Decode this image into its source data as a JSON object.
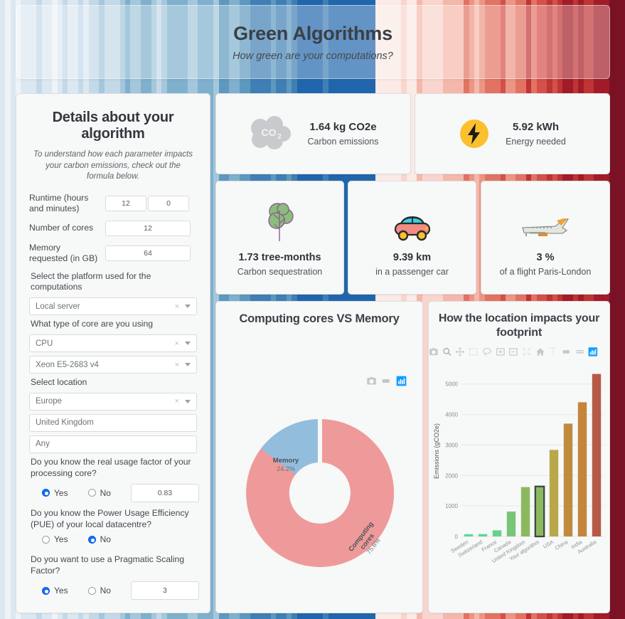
{
  "header": {
    "title": "Green Algorithms",
    "subtitle": "How green are your computations?"
  },
  "form": {
    "title": "Details about your algorithm",
    "note": "To understand how each parameter impacts your carbon emissions, check out the formula below.",
    "runtime_label": "Runtime (hours and minutes)",
    "runtime_hours": "12",
    "runtime_minutes": "0",
    "cores_label": "Number of cores",
    "cores_value": "12",
    "memory_label": "Memory requested (in GB)",
    "memory_value": "64",
    "platform_label": "Select the platform used for the computations",
    "platform_value": "Local server",
    "core_type_label": "What type of core are you using",
    "core_type_value": "CPU",
    "core_model_value": "Xeon E5-2683 v4",
    "location_label": "Select location",
    "location_continent": "Europe",
    "location_country": "United Kingdom",
    "location_region": "Any",
    "usage_label": "Do you know the real usage factor of your processing core?",
    "usage_yes": "Yes",
    "usage_no": "No",
    "usage_selected": "Yes",
    "usage_value": "0.83",
    "pue_label": "Do you know the Power Usage Efficiency (PUE) of your local datacentre?",
    "pue_yes": "Yes",
    "pue_no": "No",
    "pue_selected": "No",
    "psf_label": "Do you want to use a Pragmatic Scaling Factor?",
    "psf_yes": "Yes",
    "psf_no": "No",
    "psf_selected": "Yes",
    "psf_value": "3",
    "clear_symbol": "×"
  },
  "metrics": [
    {
      "icon": "co2-cloud-icon",
      "value": "1.64 kg CO2e",
      "label": "Carbon emissions"
    },
    {
      "icon": "lightning-bolt-icon",
      "value": "5.92 kWh",
      "label": "Energy needed"
    }
  ],
  "equivalents": [
    {
      "icon": "tree-icon",
      "value": "1.73 tree-months",
      "label": "Carbon sequestration"
    },
    {
      "icon": "car-icon",
      "value": "9.39 km",
      "label": "in a passenger car"
    },
    {
      "icon": "airplane-icon",
      "value": "3 %",
      "label": "of a flight Paris-London"
    }
  ],
  "colors": {
    "memory": "#93bddc",
    "cores": "#ef9a9a",
    "highlight_border": "#3a4348",
    "accent_blue": "#0d6efd",
    "plotly_logo": "#119dff"
  },
  "chart_data": [
    {
      "type": "pie",
      "title": "Computing cores VS Memory",
      "hole": 0.42,
      "labels": [
        "Memory",
        "Computing cores"
      ],
      "values": [
        24.2,
        75.8
      ],
      "value_suffix": "%",
      "colors": [
        "#93bddc",
        "#ef9a9a"
      ],
      "slice_text": [
        "Memory\n24.2%",
        "Computing cores\n75.8%"
      ],
      "legend": "none",
      "modebar": [
        "camera-icon",
        "hover-closest-icon",
        "plotly-logo-icon"
      ]
    },
    {
      "type": "bar",
      "title": "How the location impacts your footprint",
      "xlabel": "",
      "ylabel": "Emissions (gCO2e)",
      "ylim": [
        0,
        5600
      ],
      "yticks": [
        0,
        1000,
        2000,
        3000,
        4000,
        5000
      ],
      "grid": true,
      "categories": [
        "Sweden",
        "Switzerland",
        "France",
        "Canada",
        "United Kingdom",
        "Your algorithm",
        "USA",
        "China",
        "India",
        "Australia"
      ],
      "values": [
        75,
        80,
        200,
        820,
        1620,
        1640,
        2840,
        3700,
        4400,
        5330
      ],
      "bar_colors": [
        "#57d99a",
        "#57d99a",
        "#67d18a",
        "#79c578",
        "#8cb95f",
        "#8cb95f",
        "#b9a84a",
        "#c08b3e",
        "#c5853c",
        "#b55a46"
      ],
      "highlighted_category": "Your algorithm",
      "modebar": [
        "camera-icon",
        "zoom-icon",
        "pan-icon",
        "box-select-icon",
        "lasso-select-icon",
        "zoom-in-icon",
        "zoom-out-icon",
        "autoscale-icon",
        "reset-axes-icon",
        "spike-lines-icon",
        "hover-compare-icon",
        "hover-closest-icon",
        "plotly-logo-icon"
      ]
    }
  ]
}
